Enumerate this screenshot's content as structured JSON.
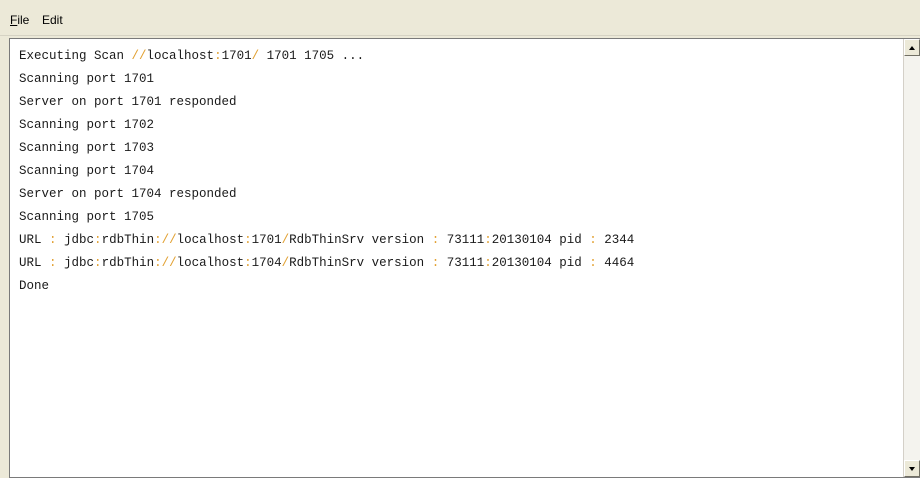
{
  "menu": {
    "file": {
      "mnemonic": "F",
      "rest": "ile"
    },
    "edit": "Edit"
  },
  "output": {
    "lines": [
      [
        {
          "t": "Executing Scan "
        },
        {
          "t": "//",
          "p": true
        },
        {
          "t": "localhost"
        },
        {
          "t": ":",
          "p": true
        },
        {
          "t": "1701"
        },
        {
          "t": "/",
          "p": true
        },
        {
          "t": " 1701 1705 ..."
        }
      ],
      [
        {
          "t": "Scanning port 1701"
        }
      ],
      [
        {
          "t": "Server on port 1701 responded"
        }
      ],
      [
        {
          "t": "Scanning port 1702"
        }
      ],
      [
        {
          "t": "Scanning port 1703"
        }
      ],
      [
        {
          "t": "Scanning port 1704"
        }
      ],
      [
        {
          "t": "Server on port 1704 responded"
        }
      ],
      [
        {
          "t": "Scanning port 1705"
        }
      ],
      [
        {
          "t": "URL "
        },
        {
          "t": ":",
          "p": true
        },
        {
          "t": " jdbc"
        },
        {
          "t": ":",
          "p": true
        },
        {
          "t": "rdbThin"
        },
        {
          "t": "://",
          "p": true
        },
        {
          "t": "localhost"
        },
        {
          "t": ":",
          "p": true
        },
        {
          "t": "1701"
        },
        {
          "t": "/",
          "p": true
        },
        {
          "t": "RdbThinSrv version "
        },
        {
          "t": ":",
          "p": true
        },
        {
          "t": " 73111"
        },
        {
          "t": ":",
          "p": true
        },
        {
          "t": "20130104 pid "
        },
        {
          "t": ":",
          "p": true
        },
        {
          "t": " 2344"
        }
      ],
      [
        {
          "t": "URL "
        },
        {
          "t": ":",
          "p": true
        },
        {
          "t": " jdbc"
        },
        {
          "t": ":",
          "p": true
        },
        {
          "t": "rdbThin"
        },
        {
          "t": "://",
          "p": true
        },
        {
          "t": "localhost"
        },
        {
          "t": ":",
          "p": true
        },
        {
          "t": "1704"
        },
        {
          "t": "/",
          "p": true
        },
        {
          "t": "RdbThinSrv version "
        },
        {
          "t": ":",
          "p": true
        },
        {
          "t": " 73111"
        },
        {
          "t": ":",
          "p": true
        },
        {
          "t": "20130104 pid "
        },
        {
          "t": ":",
          "p": true
        },
        {
          "t": " 4464"
        }
      ],
      [
        {
          "t": "Done"
        }
      ]
    ]
  },
  "scrollbar": {
    "up_icon": "arrow-up-icon",
    "down_icon": "arrow-down-icon"
  },
  "colors": {
    "window_bg": "#ece9d8",
    "output_bg": "#ffffff",
    "text": "#1a1a1a",
    "punctuation": "#e2a030"
  }
}
